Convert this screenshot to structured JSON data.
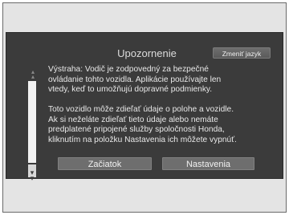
{
  "dialog": {
    "title": "Upozornenie",
    "change_language_label": "Zmeniť jazyk",
    "paragraphs": [
      [
        "Výstraha: Vodič je zodpovedný za bezpečné",
        "ovládanie tohto vozidla. Aplikácie používajte len",
        "vtedy, keď to umožňujú dopravné podmienky."
      ],
      [
        "Toto vozidlo môže zdieľať údaje o polohe a vozidle.",
        "Ak si neželáte zdieľať tieto údaje alebo nemáte",
        "predplatené pripojené služby spoločnosti Honda,",
        "kliknutím na položku Nastavenia ich môžete vypnúť."
      ]
    ],
    "start_label": "Začiatok",
    "settings_label": "Nastavenia"
  },
  "icons": {
    "scroll_up": "double-chevron-up-icon",
    "scroll_down": "double-chevron-down-icon"
  }
}
